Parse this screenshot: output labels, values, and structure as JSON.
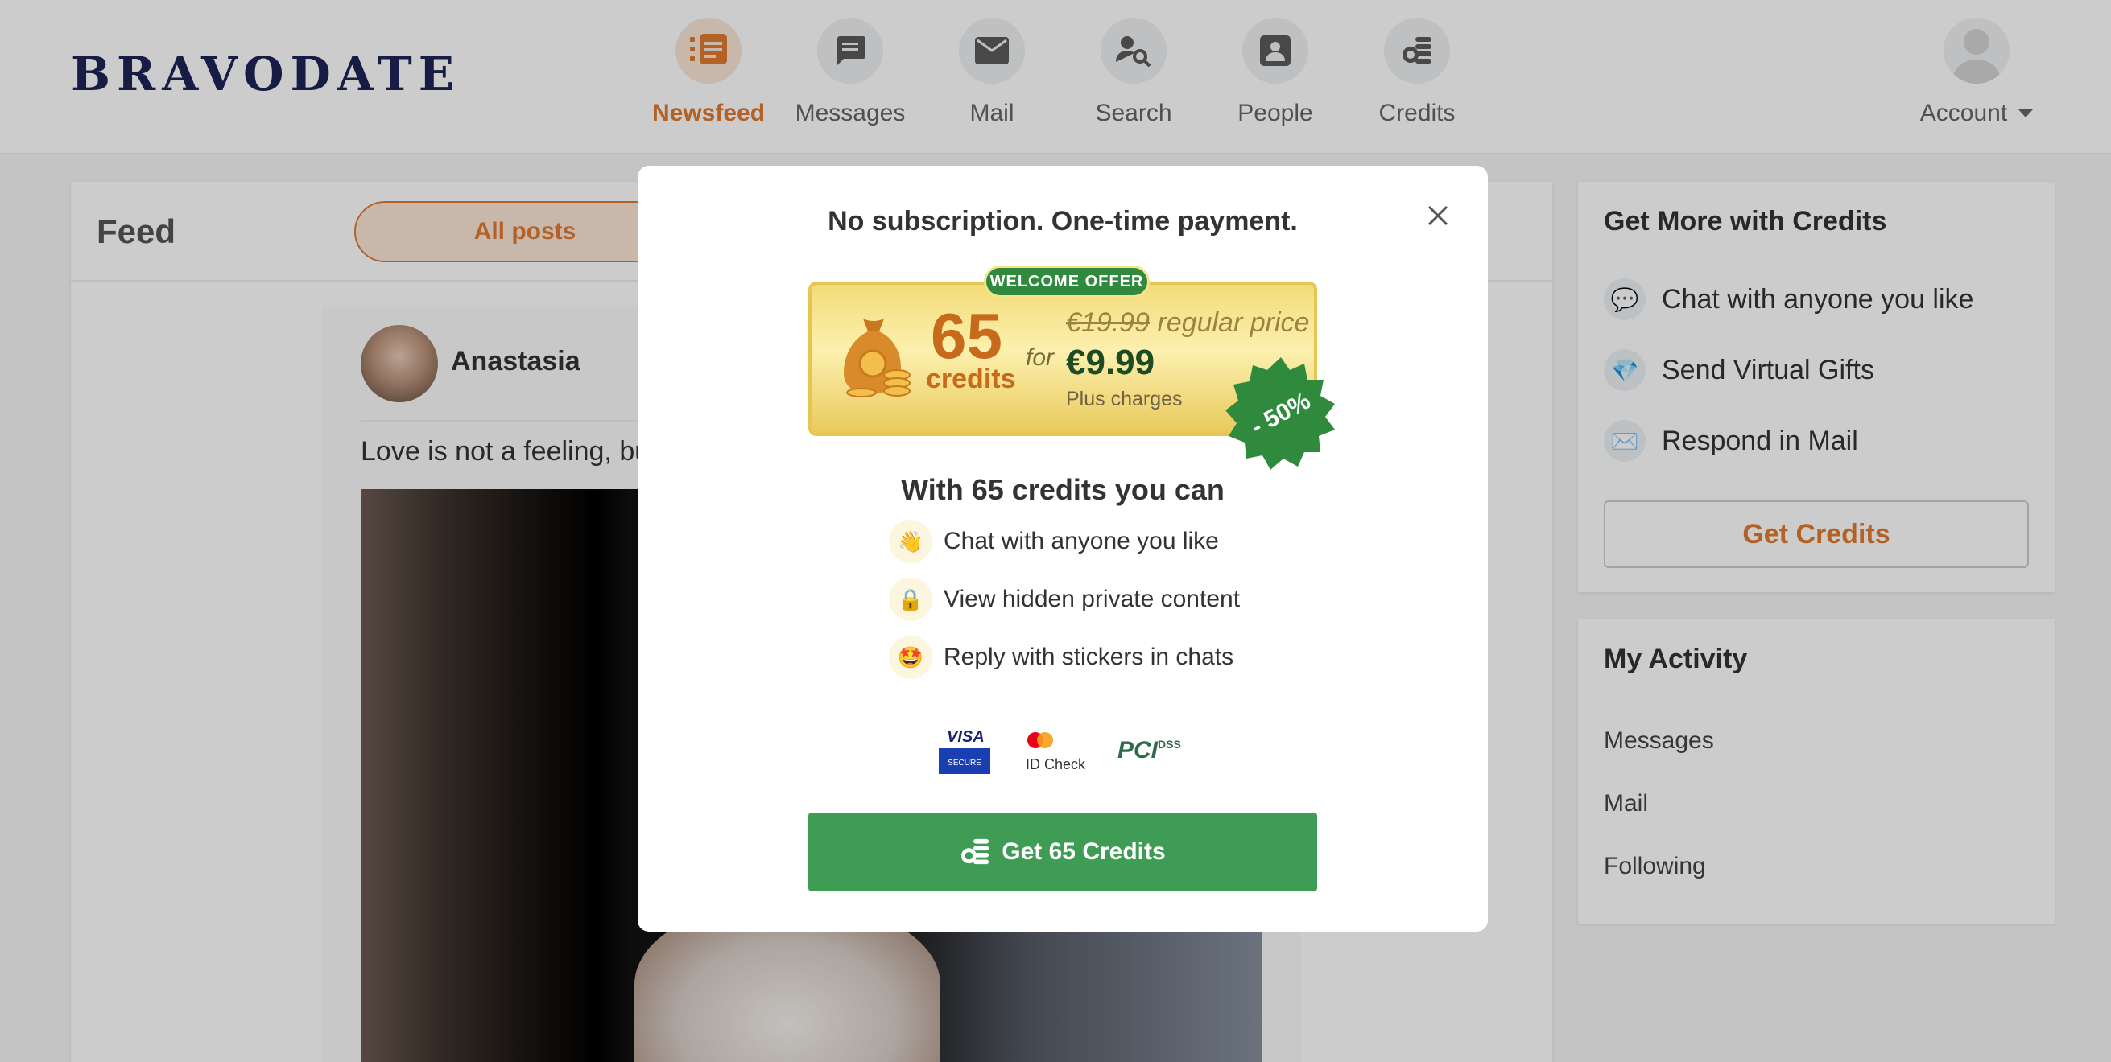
{
  "brand": {
    "logo": "BRAVODATE"
  },
  "nav": {
    "items": [
      {
        "label": "Newsfeed",
        "icon": "newsfeed-icon",
        "active": true
      },
      {
        "label": "Messages",
        "icon": "messages-icon",
        "active": false
      },
      {
        "label": "Mail",
        "icon": "mail-icon",
        "active": false
      },
      {
        "label": "Search",
        "icon": "search-person-icon",
        "active": false
      },
      {
        "label": "People",
        "icon": "people-icon",
        "active": false
      },
      {
        "label": "Credits",
        "icon": "credits-coins-icon",
        "active": false
      }
    ],
    "account_label": "Account"
  },
  "feed": {
    "title": "Feed",
    "tab_all": "All posts",
    "post": {
      "author": "Anastasia",
      "text": "Love is not a feeling, bu"
    }
  },
  "sidebar": {
    "credits_card": {
      "title": "Get More with Credits",
      "items": [
        {
          "label": "Chat with anyone you like",
          "icon": "chat-bubble-icon"
        },
        {
          "label": "Send Virtual Gifts",
          "icon": "diamond-icon"
        },
        {
          "label": "Respond in Mail",
          "icon": "envelope-icon"
        }
      ],
      "button": "Get Credits"
    },
    "activity_card": {
      "title": "My Activity",
      "links": [
        "Messages",
        "Mail",
        "Following"
      ]
    }
  },
  "modal": {
    "title": "No subscription. One-time payment.",
    "offer": {
      "badge": "WELCOME OFFER",
      "amount": "65",
      "unit": "credits",
      "for": "for",
      "old_price": "€19.99",
      "old_price_suffix": " regular price",
      "new_price": "€9.99",
      "charges_note": "Plus charges",
      "discount": "- 50%"
    },
    "benefits_title": "With 65 credits you can",
    "benefits": [
      {
        "label": "Chat with anyone you like",
        "icon": "waving-hand-icon"
      },
      {
        "label": "View hidden private content",
        "icon": "padlock-icon"
      },
      {
        "label": "Reply with stickers in chats",
        "icon": "star-struck-face-icon"
      }
    ],
    "payment_logos": {
      "visa": "VISA",
      "visa_sub": "SECURE",
      "mastercard": "ID Check",
      "pci": "PCI",
      "dss": "DSS"
    },
    "cta": "Get 65 Credits"
  },
  "colors": {
    "accent": "#e07a2e",
    "brand_navy": "#1c2454",
    "cta_green": "#3f9c54",
    "badge_green": "#2f8a3e",
    "offer_gold": "#f2dc7a"
  }
}
